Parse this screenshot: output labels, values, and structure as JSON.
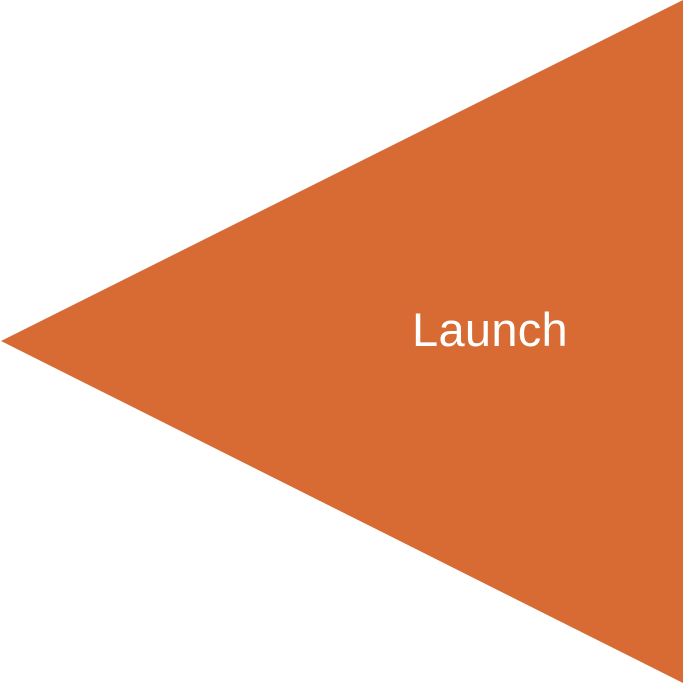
{
  "shape": {
    "type": "triangle-pointing-left",
    "fill_color": "#D76B33",
    "background_color": "#FFFFFF",
    "label_color": "#FFFFFF",
    "label": "Launch"
  }
}
